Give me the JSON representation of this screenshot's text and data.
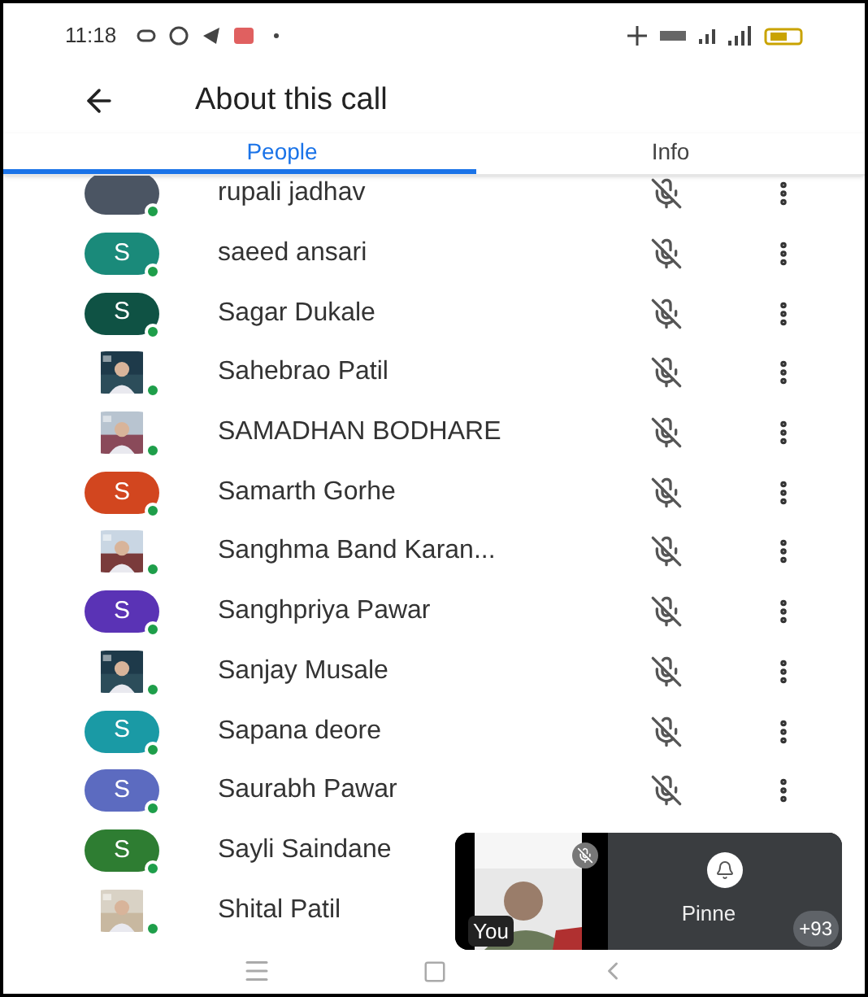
{
  "status_bar": {
    "time": "11:18"
  },
  "header": {
    "title": "About this call"
  },
  "tabs": [
    {
      "label": "People",
      "selected": true
    },
    {
      "label": "Info",
      "selected": false
    }
  ],
  "participants": [
    {
      "name": "rupali jadhav",
      "avatar": {
        "kind": "letter",
        "color": "#4b5563"
      },
      "muted": true
    },
    {
      "name": "saeed ansari",
      "avatar": {
        "kind": "letter",
        "letter": "S",
        "color": "#1a8a7a"
      },
      "muted": true
    },
    {
      "name": "Sagar Dukale",
      "avatar": {
        "kind": "letter",
        "letter": "S",
        "color": "#0f5244"
      },
      "muted": true
    },
    {
      "name": "Sahebrao Patil",
      "muted": true
    },
    {
      "name": "SAMADHAN BODHARE",
      "muted": true
    },
    {
      "name": "Samarth Gorhe",
      "avatar": {
        "kind": "letter",
        "letter": "S",
        "color": "#d2461f"
      },
      "muted": true
    },
    {
      "name": "Sanghma Band Karan...",
      "muted": true
    },
    {
      "name": "Sanghpriya Pawar",
      "avatar": {
        "kind": "letter",
        "letter": "S",
        "color": "#5a33b5"
      },
      "muted": true
    },
    {
      "name": "Sanjay Musale",
      "muted": true
    },
    {
      "name": "Sapana deore",
      "avatar": {
        "kind": "letter",
        "letter": "S",
        "color": "#1a9aa5"
      },
      "muted": true
    },
    {
      "name": "Saurabh Pawar",
      "avatar": {
        "kind": "letter",
        "letter": "S",
        "color": "#5c6bc0"
      },
      "muted": true
    },
    {
      "name": "Sayli Saindane",
      "avatar": {
        "kind": "letter",
        "letter": "S",
        "color": "#2e7d32"
      }
    },
    {
      "name": "Shital Patil"
    }
  ],
  "pip": {
    "self_label": "You",
    "pinned_label": "Pinne",
    "count_badge": "+93"
  }
}
